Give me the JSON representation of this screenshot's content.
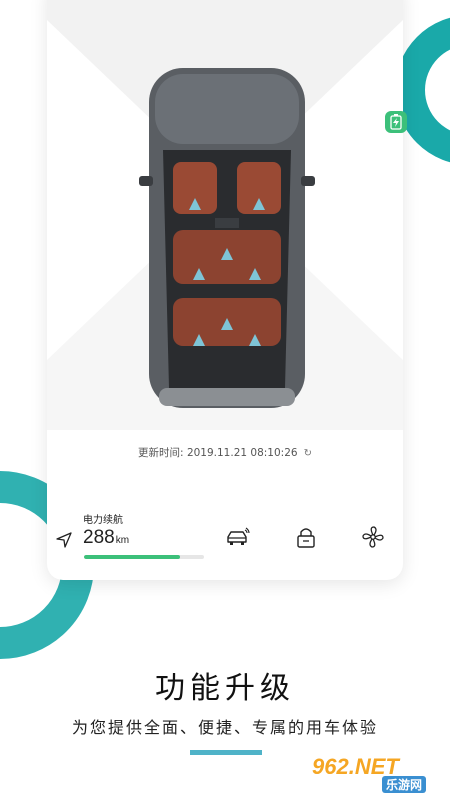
{
  "vehicle": {
    "update_label": "更新时间: ",
    "update_time": "2019.11.21 08:10:26"
  },
  "range": {
    "label": "电力续航",
    "value": "288",
    "unit": "km",
    "fill_fraction": 0.8
  },
  "controls": [
    {
      "name": "remote-start",
      "icon": "car-signal-icon"
    },
    {
      "name": "lock",
      "icon": "lock-icon"
    },
    {
      "name": "climate",
      "icon": "fan-icon"
    }
  ],
  "banner": {
    "title": "功能升级",
    "subtitle": "为您提供全面、便捷、专属的用车体验"
  },
  "watermark": {
    "main": "962",
    "main_suffix": ".NET",
    "sub": "乐游网"
  },
  "colors": {
    "accent_teal": "#1aa9a9",
    "range_green": "#3cc07a",
    "underline_blue": "#4fb3c8",
    "seat_brown": "#9a4a34"
  }
}
